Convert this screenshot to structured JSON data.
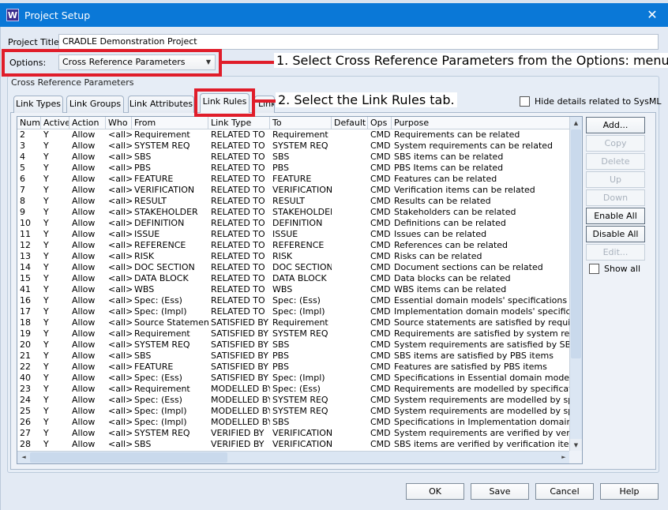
{
  "window": {
    "title": "Project Setup",
    "app_icon_letter": "W",
    "close_glyph": "✕"
  },
  "form": {
    "project_title_label": "Project Title:",
    "project_title_value": "CRADLE Demonstration Project",
    "options_label": "Options:",
    "options_value": "Cross Reference Parameters",
    "dropdown_glyph": "▼"
  },
  "annotations": {
    "step1": "1. Select Cross Reference Parameters from the Options: menu.",
    "step2": "2. Select the Link Rules tab.",
    "highlight_color": "#e01d2a"
  },
  "group": {
    "title": "Cross Reference Parameters"
  },
  "tabs": [
    {
      "label": "Link Types",
      "active": false
    },
    {
      "label": "Link Groups",
      "active": false
    },
    {
      "label": "Link Attributes",
      "active": false
    },
    {
      "label": "Link Rules",
      "active": true
    },
    {
      "label": "Link",
      "active": false
    }
  ],
  "hide_sysml": {
    "label": "Hide details related to SysML",
    "checked": false
  },
  "table": {
    "columns": [
      "Num",
      "Active",
      "Action",
      "Who",
      "From",
      "Link Type",
      "To",
      "Default",
      "Ops",
      "Purpose"
    ],
    "rows": [
      [
        "2",
        "Y",
        "Allow",
        "<all>",
        "Requirement",
        "RELATED TO",
        "Requirement",
        "",
        "CMD",
        "Requirements can be related"
      ],
      [
        "3",
        "Y",
        "Allow",
        "<all>",
        "SYSTEM REQ",
        "RELATED TO",
        "SYSTEM REQ",
        "",
        "CMD",
        "System requirements can be related"
      ],
      [
        "4",
        "Y",
        "Allow",
        "<all>",
        "SBS",
        "RELATED TO",
        "SBS",
        "",
        "CMD",
        "SBS items can be related"
      ],
      [
        "5",
        "Y",
        "Allow",
        "<all>",
        "PBS",
        "RELATED TO",
        "PBS",
        "",
        "CMD",
        "PBS Items can be related"
      ],
      [
        "6",
        "Y",
        "Allow",
        "<all>",
        "FEATURE",
        "RELATED TO",
        "FEATURE",
        "",
        "CMD",
        "Features can be related"
      ],
      [
        "7",
        "Y",
        "Allow",
        "<all>",
        "VERIFICATION",
        "RELATED TO",
        "VERIFICATION",
        "",
        "CMD",
        "Verification items can be related"
      ],
      [
        "8",
        "Y",
        "Allow",
        "<all>",
        "RESULT",
        "RELATED TO",
        "RESULT",
        "",
        "CMD",
        "Results can be related"
      ],
      [
        "9",
        "Y",
        "Allow",
        "<all>",
        "STAKEHOLDER",
        "RELATED TO",
        "STAKEHOLDER",
        "",
        "CMD",
        "Stakeholders can be related"
      ],
      [
        "10",
        "Y",
        "Allow",
        "<all>",
        "DEFINITION",
        "RELATED TO",
        "DEFINITION",
        "",
        "CMD",
        "Definitions can be related"
      ],
      [
        "11",
        "Y",
        "Allow",
        "<all>",
        "ISSUE",
        "RELATED TO",
        "ISSUE",
        "",
        "CMD",
        "Issues can be related"
      ],
      [
        "12",
        "Y",
        "Allow",
        "<all>",
        "REFERENCE",
        "RELATED TO",
        "REFERENCE",
        "",
        "CMD",
        "References can be related"
      ],
      [
        "13",
        "Y",
        "Allow",
        "<all>",
        "RISK",
        "RELATED TO",
        "RISK",
        "",
        "CMD",
        "Risks can be related"
      ],
      [
        "14",
        "Y",
        "Allow",
        "<all>",
        "DOC SECTION",
        "RELATED TO",
        "DOC SECTION",
        "",
        "CMD",
        "Document sections can be related"
      ],
      [
        "15",
        "Y",
        "Allow",
        "<all>",
        "DATA BLOCK",
        "RELATED TO",
        "DATA BLOCK",
        "",
        "CMD",
        "Data blocks can be related"
      ],
      [
        "41",
        "Y",
        "Allow",
        "<all>",
        "WBS",
        "RELATED TO",
        "WBS",
        "",
        "CMD",
        "WBS items can be related"
      ],
      [
        "16",
        "Y",
        "Allow",
        "<all>",
        "Spec: (Ess)",
        "RELATED TO",
        "Spec: (Ess)",
        "",
        "CMD",
        "Essential domain models' specifications can"
      ],
      [
        "17",
        "Y",
        "Allow",
        "<all>",
        "Spec: (Impl)",
        "RELATED TO",
        "Spec: (Impl)",
        "",
        "CMD",
        "Implementation domain models' specificatic"
      ],
      [
        "18",
        "Y",
        "Allow",
        "<all>",
        "Source Statement",
        "SATISFIED BY",
        "Requirement",
        "",
        "CMD",
        "Source statements are satisfied by requirem"
      ],
      [
        "19",
        "Y",
        "Allow",
        "<all>",
        "Requirement",
        "SATISFIED BY",
        "SYSTEM REQ",
        "",
        "CMD",
        "Requirements are satisfied by system requir"
      ],
      [
        "20",
        "Y",
        "Allow",
        "<all>",
        "SYSTEM REQ",
        "SATISFIED BY",
        "SBS",
        "",
        "CMD",
        "System requirements are satisfied by SBS ite"
      ],
      [
        "21",
        "Y",
        "Allow",
        "<all>",
        "SBS",
        "SATISFIED BY",
        "PBS",
        "",
        "CMD",
        "SBS items are satisfied by PBS items"
      ],
      [
        "22",
        "Y",
        "Allow",
        "<all>",
        "FEATURE",
        "SATISFIED BY",
        "PBS",
        "",
        "CMD",
        "Features are satisfied by PBS items"
      ],
      [
        "40",
        "Y",
        "Allow",
        "<all>",
        "Spec: (Ess)",
        "SATISFIED BY",
        "Spec: (Impl)",
        "",
        "CMD",
        "Specifications in Essential domain models a"
      ],
      [
        "23",
        "Y",
        "Allow",
        "<all>",
        "Requirement",
        "MODELLED BY",
        "Spec: (Ess)",
        "",
        "CMD",
        "Requirements are modelled by specification"
      ],
      [
        "24",
        "Y",
        "Allow",
        "<all>",
        "Spec: (Ess)",
        "MODELLED BY",
        "SYSTEM REQ",
        "",
        "CMD",
        "System requirements are modelled by specif"
      ],
      [
        "25",
        "Y",
        "Allow",
        "<all>",
        "Spec: (Impl)",
        "MODELLED BY",
        "SYSTEM REQ",
        "",
        "CMD",
        "System requirements are modelled by specif"
      ],
      [
        "26",
        "Y",
        "Allow",
        "<all>",
        "Spec: (Impl)",
        "MODELLED BY",
        "SBS",
        "",
        "CMD",
        "Specifications in Implementation domain m"
      ],
      [
        "27",
        "Y",
        "Allow",
        "<all>",
        "SYSTEM REQ",
        "VERIFIED BY",
        "VERIFICATION",
        "",
        "CMD",
        "System requirements are verified by verificat"
      ],
      [
        "28",
        "Y",
        "Allow",
        "<all>",
        "SBS",
        "VERIFIED BY",
        "VERIFICATION",
        "",
        "CMD",
        "SBS items are verified by verification items"
      ]
    ]
  },
  "scroll_glyphs": {
    "up": "▲",
    "down": "▼",
    "left": "◄",
    "right": "►"
  },
  "side_buttons": [
    {
      "label": "Add...",
      "enabled": true
    },
    {
      "label": "Copy",
      "enabled": false
    },
    {
      "label": "Delete",
      "enabled": false
    },
    {
      "label": "Up",
      "enabled": false
    },
    {
      "label": "Down",
      "enabled": false
    },
    {
      "label": "Enable All",
      "enabled": true
    },
    {
      "label": "Disable All",
      "enabled": true
    },
    {
      "label": "Edit...",
      "enabled": false
    }
  ],
  "show_all": {
    "label": "Show all",
    "checked": false
  },
  "dialog_buttons": {
    "ok": "OK",
    "save": "Save",
    "cancel": "Cancel",
    "help": "Help"
  }
}
